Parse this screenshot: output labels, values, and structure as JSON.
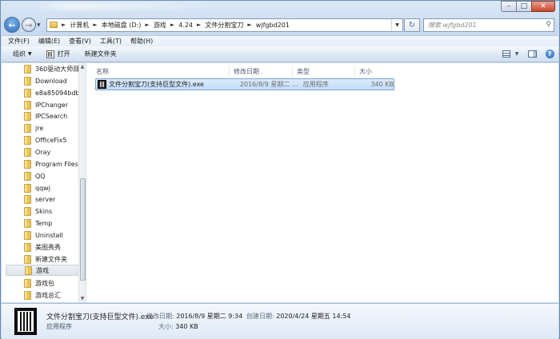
{
  "address": {
    "crumbs": [
      "计算机",
      "本地磁盘 (D:)",
      "游戏",
      "4.24",
      "文件分割宝刀",
      "wjfgbd201"
    ],
    "search_placeholder": "搜索 wjfgbd201"
  },
  "menu": [
    "文件(F)",
    "编辑(E)",
    "查看(V)",
    "工具(T)",
    "帮助(H)"
  ],
  "toolbar": {
    "organize": "组织",
    "open": "打开",
    "new_folder": "新建文件夹"
  },
  "nav_tree": [
    "360驱动大师目",
    "Download",
    "e8a85094bdb",
    "IPChanger",
    "IPCSearch",
    "jre",
    "OfficeFix5",
    "Oray",
    "Program Files",
    "QQ",
    "qqwj",
    "server",
    "Skins",
    "Temp",
    "Uninstall",
    "美图秀秀",
    "新建文件夹",
    "游戏",
    "游戏包",
    "游戏总汇"
  ],
  "selected_tree_item": "游戏",
  "columns": {
    "name": "名称",
    "modified": "修改日期",
    "type": "类型",
    "size": "大小"
  },
  "files": [
    {
      "name": "文件分割宝刀(支持巨型文件).exe",
      "modified": "2016/8/9 星期二 ...",
      "type": "应用程序",
      "size": "340 KB"
    }
  ],
  "details": {
    "name": "文件分割宝刀(支持巨型文件).exe",
    "type": "应用程序",
    "modified_label": "修改日期:",
    "modified_value": "2016/8/9 星期二 9:34",
    "created_label": "创建日期:",
    "created_value": "2020/4/24 星期五 14:54",
    "size_label": "大小:",
    "size_value": "340 KB"
  }
}
